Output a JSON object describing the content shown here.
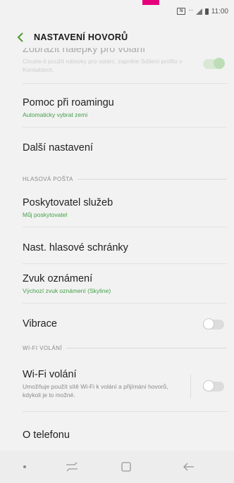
{
  "status_bar": {
    "nfc_label": "N",
    "time": "11:00"
  },
  "header": {
    "title": "NASTAVENÍ HOVORŮ"
  },
  "partial_item": {
    "title": "Zobrazit nálepky pro volání",
    "description": "Chcete-li použít nálepky pro volání, zapněte Sdílení profilu v Kontaktech.",
    "toggle_on": true
  },
  "items": [
    {
      "title": "Pomoc při roamingu",
      "subtitle": "Automaticky vybrat zemi"
    },
    {
      "title": "Další nastavení"
    }
  ],
  "section_voicemail": {
    "header": "HLASOVÁ POŠTA",
    "items": [
      {
        "title": "Poskytovatel služeb",
        "subtitle": "Můj poskytovatel"
      },
      {
        "title": "Nast. hlasové schránky"
      },
      {
        "title": "Zvuk oznámení",
        "subtitle": "Výchozí zvuk oznámení (Skyline)"
      },
      {
        "title": "Vibrace",
        "toggle_on": false
      }
    ]
  },
  "section_wifi": {
    "header": "WI-FI VOLÁNÍ",
    "item": {
      "title": "Wi-Fi volání",
      "description": "Umožňuje použít sítě Wi-Fi k volání a přijímání hovorů, kdykoli je to možné.",
      "toggle_on": false
    }
  },
  "about": {
    "title": "O telefonu"
  },
  "navbar": {
    "icons": [
      "dot-icon",
      "recent-apps-icon",
      "home-icon",
      "back-arrow-icon"
    ]
  },
  "colors": {
    "accent": "#43a047",
    "brand_tab": "#e6007e",
    "background": "#f2f2f2"
  }
}
